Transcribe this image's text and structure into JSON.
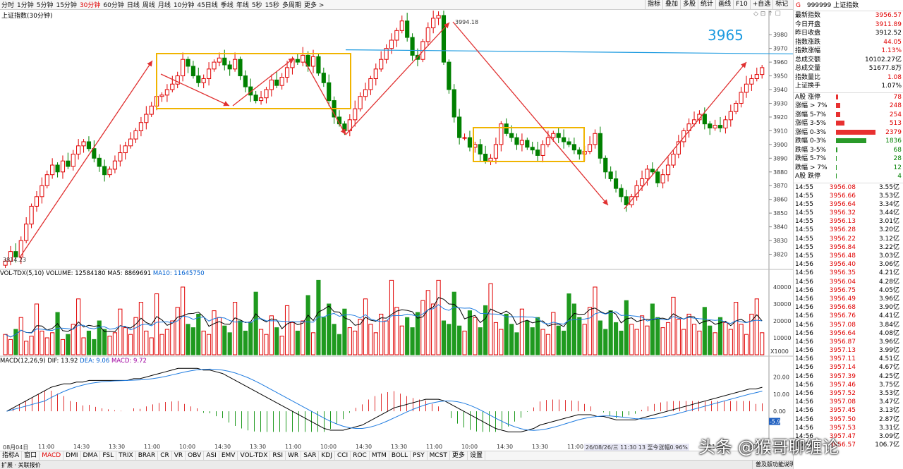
{
  "periods": [
    "分时",
    "1分钟",
    "5分钟",
    "15分钟",
    "30分钟",
    "60分钟",
    "日线",
    "周线",
    "月线",
    "10分钟",
    "45日线",
    "季线",
    "年线",
    "5秒",
    "15秒",
    "多周期",
    "更多 >"
  ],
  "active_period": "30分钟",
  "right_tools": [
    "指标",
    "叠加",
    "多股",
    "统计",
    "画线",
    "F10",
    "+自选",
    "标记"
  ],
  "chart_title": "上证指数(30分钟)",
  "price_ticks": [
    "3980",
    "3970",
    "3960",
    "3950",
    "3940",
    "3930",
    "3920",
    "3910",
    "3900",
    "3890",
    "3880",
    "3870",
    "3860",
    "3850",
    "3840",
    "3830",
    "3820"
  ],
  "annotation_3965": "3965",
  "high_label": "3994.18",
  "low_label": "3814.23",
  "vol_header": {
    "name": "VOL-TDX(5,10)",
    "volume": "VOLUME: 12584180",
    "ma5": "MA5: 8869691",
    "ma10": "MA10: 11645750"
  },
  "vol_ticks": [
    "40000",
    "30000",
    "20000",
    "10000"
  ],
  "vol_unit": "X1000",
  "macd_header": {
    "name": "MACD(12,26,9)",
    "dif": "DIF: 13.92",
    "dea": "DEA: 9.06",
    "macd": "MACD: 9.72"
  },
  "macd_ticks": [
    "20.00",
    "10.00",
    "0.00"
  ],
  "macd_last": "-5.9",
  "time_labels": [
    "08月04日",
    "11:00",
    "14:30",
    "13:30",
    "11:00",
    "10:00",
    "14:30",
    "13:30",
    "11:00",
    "10:00",
    "14:30",
    "13:30",
    "11:00",
    "10:00",
    "14:30",
    "13:30",
    "11:00",
    "10:00",
    "14:30",
    "13:30",
    "11:00",
    "10:00"
  ],
  "status_overlay": "26/08/26/三 11:30 13 至今涨幅0.96%",
  "indicators": [
    "指标A",
    "窗口",
    "MACD",
    "DMI",
    "DMA",
    "FSL",
    "TRIX",
    "BRAR",
    "CR",
    "VR",
    "OBV",
    "ASI",
    "EMV",
    "VOL-TDX",
    "RSI",
    "WR",
    "SAR",
    "KDJ",
    "CCI",
    "ROC",
    "MTM",
    "BOLL",
    "PSY",
    "MCST",
    "更多",
    "设置"
  ],
  "active_indicator": "MACD",
  "status_left": "扩展 · 关联报价",
  "status_right": [
    "普及版功能说明",
    "笔",
    "价",
    "势",
    "联",
    "主",
    "逆",
    "筹"
  ],
  "watermark": "头条 @猴哥聊缠论",
  "quote": {
    "code": "999999",
    "name": "上证指数",
    "rows": [
      {
        "k": "最新指数",
        "v": "3956.57",
        "c": "red"
      },
      {
        "k": "今日开盘",
        "v": "3911.89",
        "c": "red"
      },
      {
        "k": "昨日收盘",
        "v": "3912.52",
        "c": ""
      },
      {
        "k": "指数涨跌",
        "v": "44.05",
        "c": "red"
      },
      {
        "k": "指数涨幅",
        "v": "1.13%",
        "c": "red"
      },
      {
        "k": "总成交额",
        "v": "10102.27亿",
        "c": ""
      },
      {
        "k": "总成交量",
        "v": "51677.8万",
        "c": ""
      },
      {
        "k": "指数量比",
        "v": "1.08",
        "c": "red"
      },
      {
        "k": "上证换手",
        "v": "1.07%",
        "c": ""
      }
    ],
    "breadth": [
      {
        "k": "A股 涨停",
        "v": "78",
        "c": "red",
        "w": 3
      },
      {
        "k": "涨幅 > 7%",
        "v": "248",
        "c": "red",
        "w": 6
      },
      {
        "k": "涨幅 5-7%",
        "v": "254",
        "c": "red",
        "w": 6
      },
      {
        "k": "涨幅 3-5%",
        "v": "513",
        "c": "red",
        "w": 12
      },
      {
        "k": "涨幅 0-3%",
        "v": "2379",
        "c": "red",
        "w": 56
      },
      {
        "k": "跌幅 0-3%",
        "v": "1836",
        "c": "green",
        "w": 43
      },
      {
        "k": "跌幅 3-5%",
        "v": "68",
        "c": "green",
        "w": 2
      },
      {
        "k": "跌幅 5-7%",
        "v": "28",
        "c": "green",
        "w": 1
      },
      {
        "k": "跌幅 > 7%",
        "v": "12",
        "c": "green",
        "w": 1
      },
      {
        "k": "A股 跌停",
        "v": "4",
        "c": "green",
        "w": 1
      }
    ],
    "ticks": [
      [
        "14:55",
        "3956.08",
        "3.55亿"
      ],
      [
        "14:55",
        "3956.66",
        "3.53亿"
      ],
      [
        "14:55",
        "3956.64",
        "3.34亿"
      ],
      [
        "14:55",
        "3956.32",
        "3.44亿"
      ],
      [
        "14:55",
        "3956.13",
        "3.01亿"
      ],
      [
        "14:55",
        "3956.28",
        "3.20亿"
      ],
      [
        "14:55",
        "3956.22",
        "3.12亿"
      ],
      [
        "14:55",
        "3956.84",
        "3.22亿"
      ],
      [
        "14:55",
        "3956.48",
        "3.03亿"
      ],
      [
        "14:56",
        "3956.40",
        "3.06亿"
      ],
      [
        "14:56",
        "3956.35",
        "4.21亿"
      ],
      [
        "14:56",
        "3956.04",
        "4.28亿"
      ],
      [
        "14:56",
        "3956.75",
        "4.05亿"
      ],
      [
        "14:56",
        "3956.49",
        "3.96亿"
      ],
      [
        "14:56",
        "3956.68",
        "3.90亿"
      ],
      [
        "14:56",
        "3956.76",
        "4.41亿"
      ],
      [
        "14:56",
        "3957.08",
        "3.84亿"
      ],
      [
        "14:56",
        "3956.64",
        "4.08亿"
      ],
      [
        "14:56",
        "3956.87",
        "3.96亿"
      ],
      [
        "14:56",
        "3957.13",
        "3.99亿"
      ],
      [
        "14:56",
        "3957.11",
        "4.51亿"
      ],
      [
        "14:56",
        "3957.14",
        "4.67亿"
      ],
      [
        "14:56",
        "3957.39",
        "4.25亿"
      ],
      [
        "14:56",
        "3957.46",
        "3.75亿"
      ],
      [
        "14:56",
        "3957.52",
        "3.53亿"
      ],
      [
        "14:56",
        "3957.08",
        "3.47亿"
      ],
      [
        "14:56",
        "3957.45",
        "3.13亿"
      ],
      [
        "14:56",
        "3957.50",
        "2.87亿"
      ],
      [
        "14:56",
        "3957.53",
        "3.31亿"
      ],
      [
        "14:56",
        "3957.47",
        "3.09亿"
      ],
      [
        "15:00",
        "3956.57",
        "106.7亿"
      ]
    ]
  },
  "chart_data": {
    "type": "candlestick",
    "price_range": [
      3810,
      3995
    ],
    "closes": [
      3815,
      3822,
      3818,
      3830,
      3842,
      3855,
      3862,
      3870,
      3878,
      3885,
      3880,
      3888,
      3884,
      3893,
      3899,
      3902,
      3897,
      3890,
      3884,
      3878,
      3882,
      3888,
      3894,
      3899,
      3904,
      3910,
      3916,
      3922,
      3928,
      3935,
      3936,
      3940,
      3944,
      3950,
      3962,
      3957,
      3950,
      3945,
      3948,
      3955,
      3960,
      3963,
      3958,
      3955,
      3962,
      3950,
      3942,
      3936,
      3932,
      3934,
      3940,
      3947,
      3943,
      3949,
      3956,
      3962,
      3960,
      3965,
      3957,
      3964,
      3952,
      3945,
      3932,
      3920,
      3915,
      3910,
      3918,
      3926,
      3935,
      3940,
      3948,
      3955,
      3962,
      3970,
      3976,
      3983,
      3990,
      3978,
      3965,
      3962,
      3975,
      3985,
      3992,
      3994,
      3960,
      3940,
      3920,
      3905,
      3905,
      3898,
      3900,
      3893,
      3888,
      3890,
      3900,
      3915,
      3908,
      3905,
      3900,
      3903,
      3898,
      3896,
      3892,
      3900,
      3905,
      3908,
      3905,
      3902,
      3900,
      3896,
      3893,
      3895,
      3900,
      3908,
      3890,
      3880,
      3875,
      3868,
      3862,
      3856,
      3862,
      3870,
      3875,
      3882,
      3880,
      3872,
      3878,
      3885,
      3893,
      3902,
      3910,
      3915,
      3918,
      3922,
      3915,
      3912,
      3914,
      3912,
      3918,
      3924,
      3930,
      3938,
      3944,
      3948,
      3951,
      3956
    ],
    "volumes": [
      12,
      9,
      15,
      22,
      8,
      11,
      30,
      14,
      10,
      13,
      25,
      9,
      12,
      18,
      33,
      10,
      14,
      9,
      20,
      15,
      11,
      13,
      27,
      16,
      12,
      22,
      31,
      14,
      10,
      36,
      12,
      15,
      20,
      28,
      40,
      18,
      16,
      24,
      14,
      12,
      26,
      22,
      17,
      13,
      31,
      20,
      14,
      19,
      37,
      15,
      12,
      23,
      16,
      11,
      29,
      19,
      14,
      20,
      35,
      13,
      44,
      22,
      30,
      18,
      12,
      27,
      16,
      14,
      21,
      33,
      18,
      13,
      24,
      20,
      44,
      28,
      17,
      22,
      16,
      25,
      32,
      38,
      30,
      44,
      20,
      18,
      37,
      17,
      14,
      26,
      22,
      16,
      29,
      42,
      19,
      15,
      24,
      18,
      13,
      27,
      20,
      16,
      22,
      15,
      12,
      25,
      17,
      14,
      36,
      30,
      22,
      18,
      28,
      40,
      20,
      15,
      26,
      19,
      14,
      32,
      18,
      15,
      23,
      17,
      30,
      22,
      16,
      19,
      34,
      21,
      15,
      24,
      18,
      14,
      28,
      17,
      13,
      22,
      19,
      15,
      31,
      18,
      12,
      24,
      33,
      13
    ],
    "macd_dif": [
      0,
      2,
      4,
      6,
      8,
      10,
      12,
      14,
      15,
      16,
      16,
      17,
      17,
      18,
      18,
      18,
      18,
      18,
      18,
      18,
      19,
      19,
      20,
      21,
      22,
      23,
      24,
      25,
      25,
      25,
      25,
      24,
      24,
      23,
      22,
      20,
      18,
      16,
      14,
      12,
      10,
      8,
      6,
      4,
      2,
      0,
      -2,
      -4,
      -6,
      -8,
      -10,
      -11,
      -11,
      -11,
      -10,
      -9,
      -8,
      -6,
      -4,
      -2,
      0,
      2,
      3,
      4,
      5,
      6,
      7,
      7,
      7,
      6,
      4,
      2,
      0,
      -2,
      -4,
      -6,
      -8,
      -10,
      -11,
      -12,
      -12,
      -12,
      -11,
      -10,
      -8,
      -7,
      -6,
      -5,
      -4,
      -3,
      -2,
      -2,
      -2,
      -3,
      -3,
      -4,
      -5,
      -5,
      -5,
      -5,
      -4,
      -3,
      -2,
      -1,
      0,
      1,
      2,
      3,
      4,
      5,
      6,
      7,
      8,
      9,
      10,
      11,
      12,
      13,
      13,
      14
    ]
  }
}
